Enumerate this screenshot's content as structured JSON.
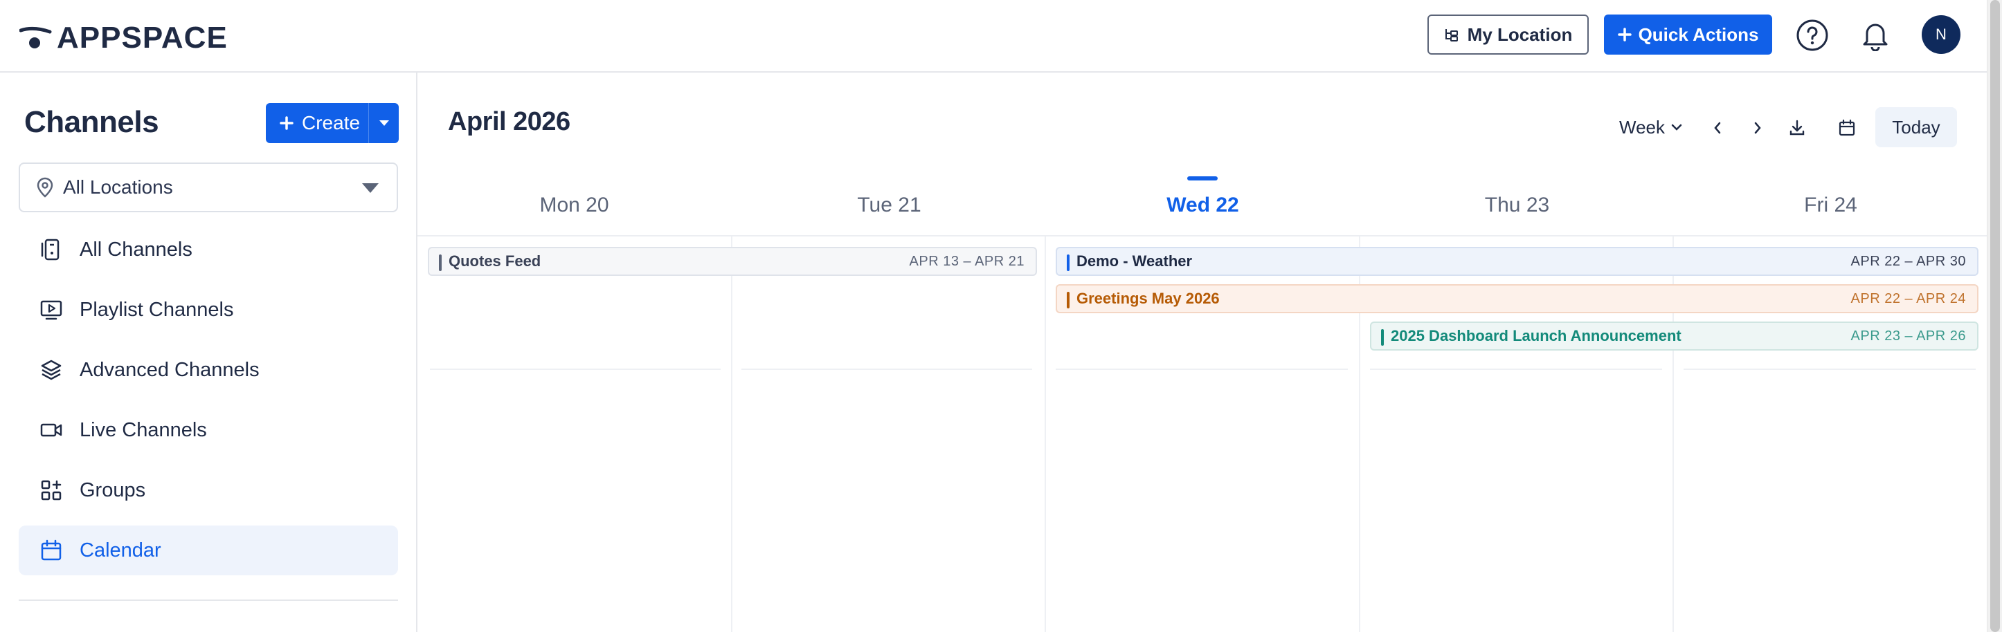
{
  "header": {
    "logo_text": "APPSPACE",
    "my_location_label": "My Location",
    "quick_actions_label": "Quick Actions",
    "avatar_initial": "N"
  },
  "sidebar": {
    "title": "Channels",
    "create_label": "Create",
    "location_select": "All Locations",
    "items": [
      {
        "label": "All Channels",
        "icon": "channels-icon"
      },
      {
        "label": "Playlist Channels",
        "icon": "playlist-icon"
      },
      {
        "label": "Advanced Channels",
        "icon": "layers-icon"
      },
      {
        "label": "Live Channels",
        "icon": "video-icon"
      },
      {
        "label": "Groups",
        "icon": "groups-icon"
      },
      {
        "label": "Calendar",
        "icon": "calendar-icon",
        "active": true
      }
    ]
  },
  "calendar": {
    "month_title": "April 2026",
    "view_select": "Week",
    "today_label": "Today",
    "days": [
      "Mon 20",
      "Tue 21",
      "Wed 22",
      "Thu 23",
      "Fri 24"
    ],
    "current_day": "Wed 22",
    "events": [
      {
        "name": "Quotes Feed",
        "dates": "APR 13 – APR 21",
        "color": "#5b6478",
        "bg": "#f6f7f9",
        "border": "#dfe3ea",
        "text": "#3a4257"
      },
      {
        "name": "Demo - Weather",
        "dates": "APR 22 – APR 30",
        "color": "#1160e8",
        "bg": "#eef3fb",
        "border": "#d6e0f1",
        "text": "#1f2a44"
      },
      {
        "name": "Greetings May 2026",
        "dates": "APR 22 – APR 24",
        "color": "#b65b05",
        "bg": "#fdf1ea",
        "border": "#f4d6c4",
        "text": "#b65b05"
      },
      {
        "name": "2025 Dashboard Launch Announcement",
        "dates": "APR 23 – APR 26",
        "color": "#138a7a",
        "bg": "#eef6f5",
        "border": "#cfe5e1",
        "text": "#138a7a"
      }
    ]
  }
}
